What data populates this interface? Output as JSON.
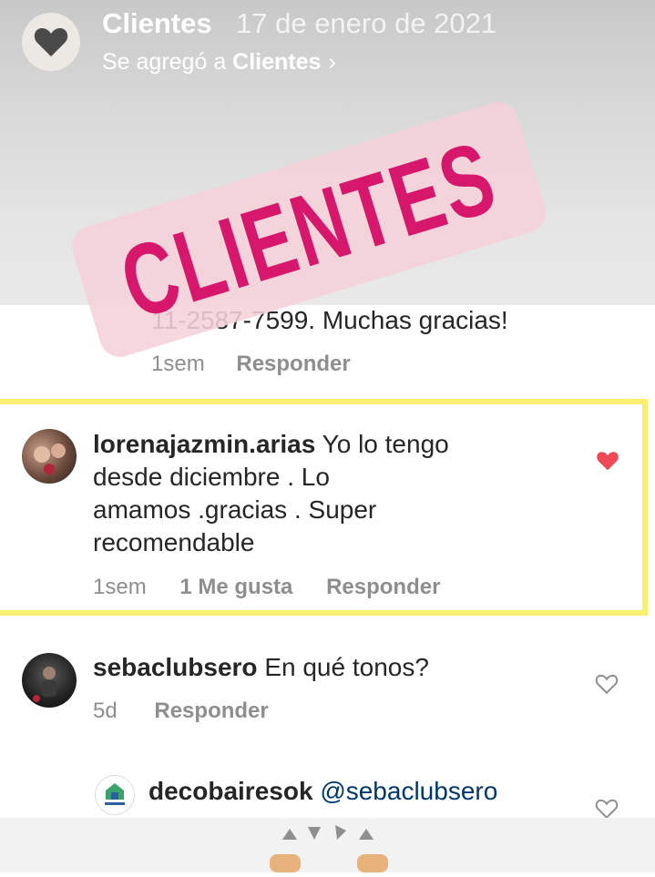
{
  "header": {
    "title": "Clientes",
    "date": "17 de enero de 2021",
    "added_prefix": "Se agregó a ",
    "added_target": "Clientes",
    "chevron": "›",
    "avatar_icon": "heart-icon"
  },
  "sticker": {
    "text": "CLIENTES",
    "color": "#d6176c"
  },
  "comments": [
    {
      "text": "11-2587-7599. Muchas gracias!",
      "time": "1sem",
      "reply": "Responder"
    },
    {
      "username": "lorenajazmin.arias",
      "text_line1": "Yo lo tengo",
      "text_line2": "desde diciembre . Lo",
      "text_line3": "amamos .gracias . Super",
      "text_line4": "recomendable",
      "time": "1sem",
      "likes": "1 Me gusta",
      "reply": "Responder",
      "liked": true,
      "like_color": "#ed4956"
    },
    {
      "username": "sebaclubsero",
      "text": "En qué tonos?",
      "time": "5d",
      "reply": "Responder",
      "liked": false
    },
    {
      "username": "decobairesok",
      "mention": "@sebaclubsero",
      "liked": false
    }
  ],
  "highlight_color": "#f7f06e"
}
